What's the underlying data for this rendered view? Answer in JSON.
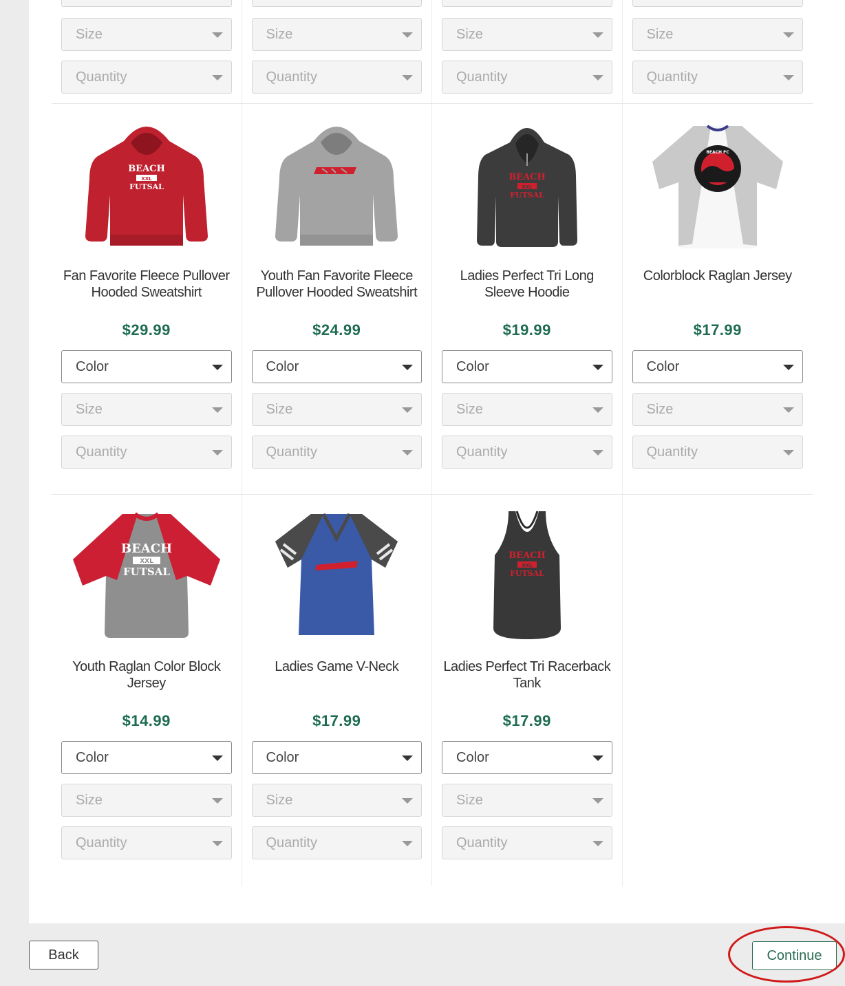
{
  "controls": {
    "color": "Color",
    "size": "Size",
    "quantity": "Quantity"
  },
  "top_row_count": 4,
  "products": [
    {
      "name": "Fan Favorite Fleece Pullover Hooded Sweatshirt",
      "price": "$29.99",
      "print": [
        "BEACH",
        "XXL",
        "FUTSAL"
      ]
    },
    {
      "name": "Youth Fan Favorite Fleece Pullover Hooded Sweatshirt",
      "price": "$24.99"
    },
    {
      "name": "Ladies Perfect Tri Long Sleeve Hoodie",
      "price": "$19.99",
      "print": [
        "BEACH",
        "XXL",
        "FUTSAL"
      ]
    },
    {
      "name": "Colorblock Raglan Jersey",
      "price": "$17.99",
      "print": [
        "BEACH FC"
      ]
    },
    {
      "name": "Youth Raglan Color Block Jersey",
      "price": "$14.99",
      "print": [
        "BEACH",
        "XXL",
        "FUTSAL"
      ]
    },
    {
      "name": "Ladies Game V-Neck",
      "price": "$17.99"
    },
    {
      "name": "Ladies Perfect Tri Racerback Tank",
      "price": "$17.99",
      "print": [
        "BEACH",
        "XXL",
        "FUTSAL"
      ]
    }
  ],
  "footer": {
    "back_label": "Back",
    "continue_label": "Continue"
  },
  "colors": {
    "price": "#1d6b52",
    "continue": "#2c6e55",
    "highlight_ring": "#d01a1a"
  }
}
